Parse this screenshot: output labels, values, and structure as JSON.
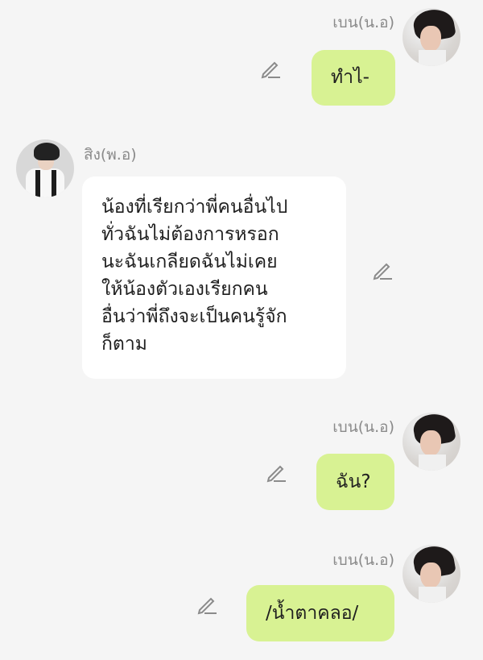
{
  "messages": [
    {
      "sender": "เบน(น.อ)",
      "text": "ทำไ-"
    },
    {
      "sender": "สิง(พ.อ)",
      "text": "น้องที่เรียกว่าพี่คนอื่นไป\nทั่วฉันไม่ต้องการหรอก\nนะฉันเกลียดฉันไม่เคย\nให้น้องตัวเองเรียกคน\nอื่นว่าพี่ถึงจะเป็นคนรู้จัก\nก็ตาม"
    },
    {
      "sender": "เบน(น.อ)",
      "text": "ฉัน?"
    },
    {
      "sender": "เบน(น.อ)",
      "text": "/น้ำตาคลอ/"
    }
  ],
  "colors": {
    "outgoing_bubble": "#d8f293",
    "incoming_bubble": "#ffffff",
    "background": "#f5f5f5",
    "name_text": "#8a8a8a"
  },
  "icons": {
    "edit": "pencil-icon"
  }
}
